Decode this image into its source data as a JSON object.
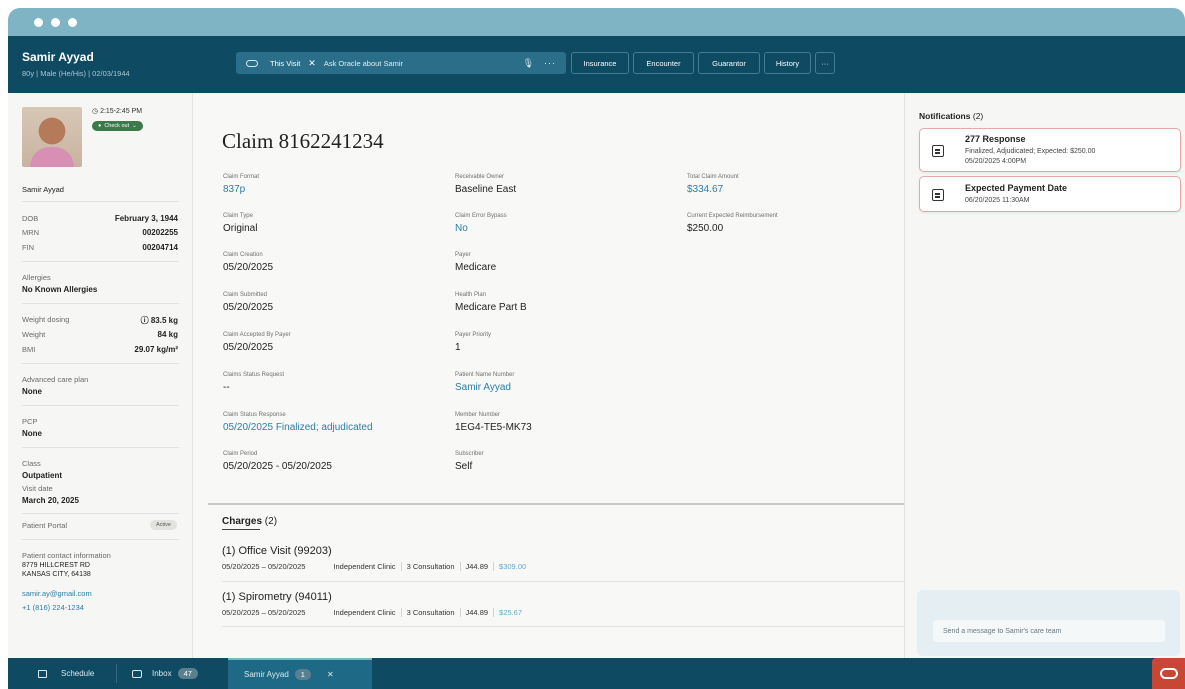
{
  "patient": {
    "name": "Samir Ayyad",
    "meta": "80y | Male (He/His) | 02/03/1944",
    "time": "2:15-2:45 PM",
    "status": "Check out",
    "dob_label": "DOB",
    "dob": "February 3, 1944",
    "mrn_label": "MRN",
    "mrn": "00202255",
    "fin_label": "FIN",
    "fin": "00204714",
    "allergies_label": "Allergies",
    "allergies": "No Known Allergies",
    "weight_dosing_label": "Weight dosing",
    "weight_dosing": "83.5 kg",
    "weight_label": "Weight",
    "weight": "84 kg",
    "bmi_label": "BMI",
    "bmi": "29.07 kg/m²",
    "acp_label": "Advanced care plan",
    "acp": "None",
    "pcp_label": "PCP",
    "pcp": "None",
    "class_label": "Class",
    "class": "Outpatient",
    "visit_date_label": "Visit date",
    "visit_date": "March 20, 2025",
    "portal_label": "Patient Portal",
    "portal_status": "Active",
    "contact_label": "Patient contact information",
    "address1": "8779 HILLCREST RD",
    "address2": "KANSAS CITY, 64138",
    "email": "samir.ay@gmail.com",
    "phone": "+1 (816) 224-1234"
  },
  "topbar": {
    "this_visit": "This Visit",
    "ask_placeholder": "Ask Oracle about Samir",
    "buttons": [
      "Insurance",
      "Encounter",
      "Guarantor",
      "History",
      "···"
    ]
  },
  "claim": {
    "title": "Claim  8162241234",
    "fields": [
      {
        "label": "Claim Format",
        "value": "837p",
        "link": true
      },
      {
        "label": "Claim Type",
        "value": "Original"
      },
      {
        "label": "Claim Creation",
        "value": "05/20/2025"
      },
      {
        "label": "Claim Submitted",
        "value": "05/20/2025"
      },
      {
        "label": "Claim Accepted By Payer",
        "value": "05/20/2025"
      },
      {
        "label": "Claims Status Request",
        "value": "--"
      },
      {
        "label": "Claim Status Response",
        "value": "05/20/2025 Finalized; adjudicated",
        "link": true
      },
      {
        "label": "Claim Period",
        "value": "05/20/2025 - 05/20/2025"
      },
      {
        "label": "Receivable Owner",
        "value": "Baseline East"
      },
      {
        "label": "Claim Error Bypass",
        "value": "No",
        "link": true
      },
      {
        "label": "Payer",
        "value": "Medicare"
      },
      {
        "label": "Health Plan",
        "value": "Medicare Part B"
      },
      {
        "label": "Payer Priority",
        "value": "1"
      },
      {
        "label": "Patient Name Number",
        "value": "Samir Ayyad",
        "link": true
      },
      {
        "label": "Member Number",
        "value": "1EG4-TE5-MK73"
      },
      {
        "label": "Subscriber",
        "value": "Self"
      },
      {
        "label": "Total Claim Amount",
        "value": "$334.67",
        "link": true
      },
      {
        "label": "Current Expected Reimbursement",
        "value": "$250.00"
      }
    ]
  },
  "charges": {
    "heading": "Charges",
    "count": "(2)",
    "items": [
      {
        "name": "(1) Office Visit (99203)",
        "dates": "05/20/2025 – 05/20/2025",
        "clinic": "Independent Clinic",
        "type": "3 Consultation",
        "code": "J44.89",
        "amount": "$309.00"
      },
      {
        "name": "(1) Spirometry (94011)",
        "dates": "05/20/2025 – 05/20/2025",
        "clinic": "Independent Clinic",
        "type": "3 Consultation",
        "code": "J44.89",
        "amount": "$25.67"
      }
    ]
  },
  "notifications": {
    "heading": "Notifications",
    "count": "(2)",
    "items": [
      {
        "title": "277 Response",
        "line1": "Finalized, Adjudicated; Expected: $250.00",
        "line2": "05/20/2025 4:00PM"
      },
      {
        "title": "Expected Payment Date",
        "line1": "06/20/2025 11:30AM"
      }
    ]
  },
  "message": {
    "placeholder": "Send a message to Samir's care team"
  },
  "bottombar": {
    "schedule": "Schedule",
    "inbox": "Inbox",
    "inbox_count": "47",
    "tab": "Samir Ayyad",
    "tab_count": "1",
    "close": "✕"
  },
  "colors": {
    "header": "#0f4a63",
    "link": "#2b7fa6",
    "oracle": "#c74634",
    "alert_border": "#e6a8a8"
  }
}
